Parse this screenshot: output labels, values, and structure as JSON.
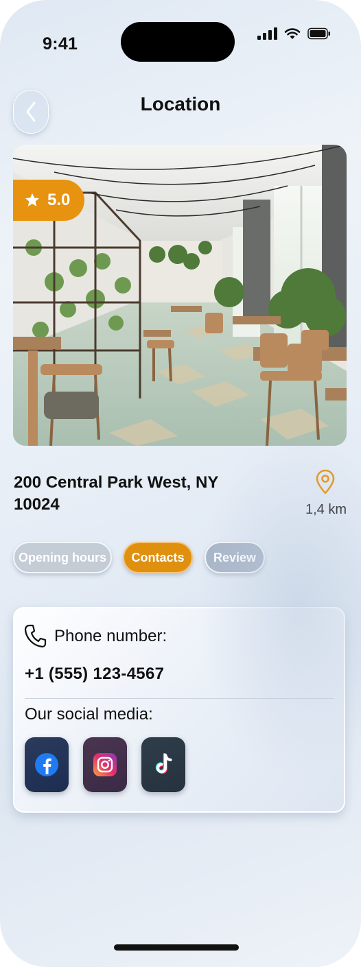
{
  "status_bar": {
    "time": "9:41"
  },
  "header": {
    "title": "Location",
    "back_icon": "chevron-left-icon"
  },
  "place": {
    "rating": "5.0",
    "address": "200 Central Park West, NY 10024",
    "distance": "1,4 km",
    "photo": "restaurant-interior-photo"
  },
  "tabs": [
    {
      "label": "Opening hours",
      "active": false
    },
    {
      "label": "Contacts",
      "active": true
    },
    {
      "label": "Review",
      "active": false
    }
  ],
  "contacts": {
    "phone_label": "Phone number:",
    "phone_value": "+1 (555) 123-4567",
    "social_label": "Our social media:",
    "socials": [
      "facebook-icon",
      "instagram-icon",
      "tiktok-icon"
    ]
  },
  "colors": {
    "accent": "#e8930f",
    "tab_inactive": "#c4ccd6",
    "tab_review": "#a9b6c8"
  }
}
